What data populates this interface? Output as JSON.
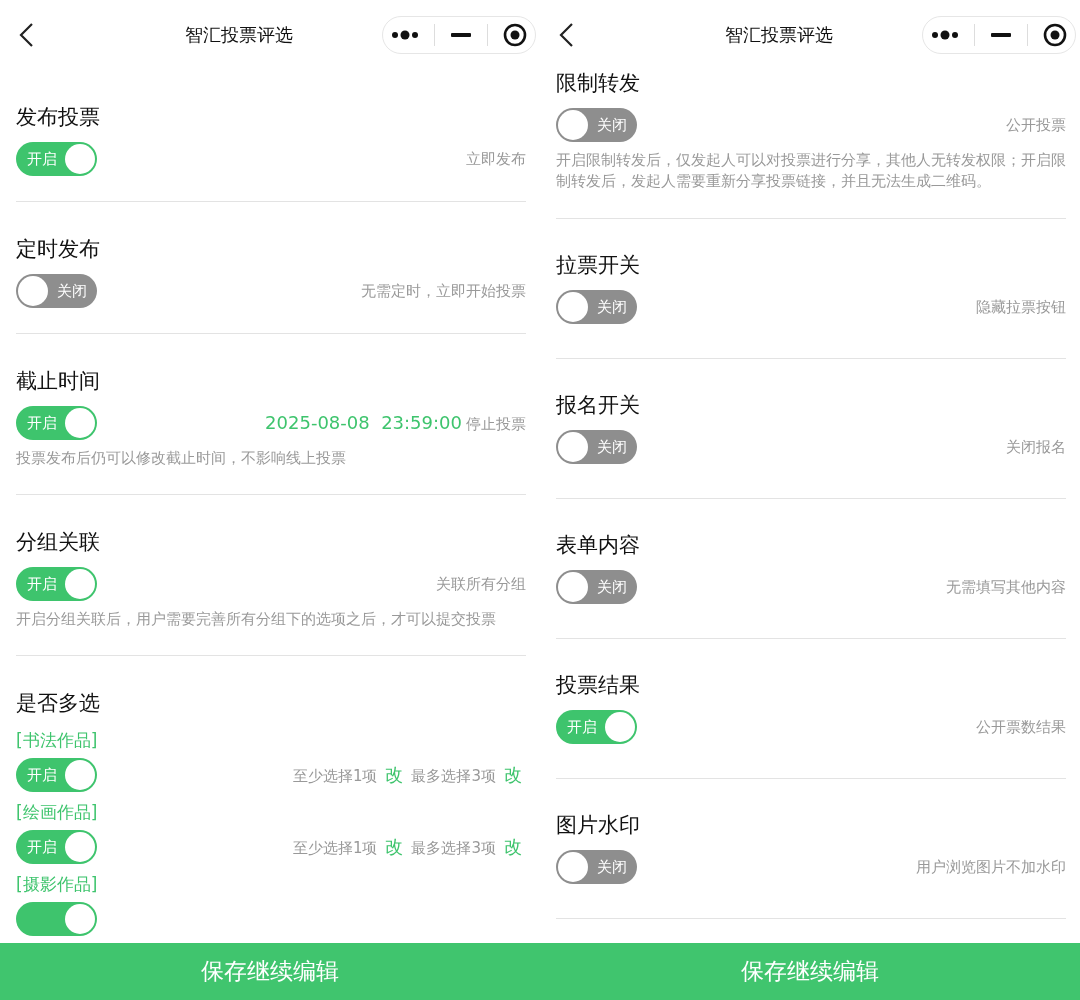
{
  "screens": [
    {
      "title": "智汇投票评选",
      "settings": [
        {
          "title": "发布投票",
          "on": true,
          "toggle_label": "开启",
          "note": [
            {
              "kind": "text",
              "text": "立即发布"
            }
          ]
        },
        {
          "title": "定时发布",
          "on": false,
          "toggle_label": "关闭",
          "note": [
            {
              "kind": "text",
              "text": "无需定时，立即开始投票"
            }
          ]
        },
        {
          "title": "截止时间",
          "on": true,
          "toggle_label": "开启",
          "note": [
            {
              "kind": "value",
              "text": "2025-08-08  23:59:00"
            },
            {
              "kind": "text",
              "text": "停止投票"
            }
          ],
          "description": "投票发布后仍可以修改截止时间，不影响线上投票"
        },
        {
          "title": "分组关联",
          "on": true,
          "toggle_label": "开启",
          "note": [
            {
              "kind": "text",
              "text": "关联所有分组"
            }
          ],
          "description": "开启分组关联后，用户需要完善所有分组下的选项之后，才可以提交投票"
        },
        {
          "title": "是否多选",
          "groups": [
            {
              "name": "[书法作品]",
              "on": true,
              "toggle_label": "开启",
              "note": [
                {
                  "kind": "text",
                  "text": "至少选择1项"
                },
                {
                  "kind": "link",
                  "text": "改"
                },
                {
                  "kind": "text",
                  "text": "最多选择3项"
                },
                {
                  "kind": "link",
                  "text": "改"
                }
              ]
            },
            {
              "name": "[绘画作品]",
              "on": true,
              "toggle_label": "开启",
              "note": [
                {
                  "kind": "text",
                  "text": "至少选择1项"
                },
                {
                  "kind": "link",
                  "text": "改"
                },
                {
                  "kind": "text",
                  "text": "最多选择3项"
                },
                {
                  "kind": "link",
                  "text": "改"
                }
              ]
            },
            {
              "name": "[摄影作品]",
              "on": true
            }
          ]
        }
      ],
      "save_button": "保存继续编辑"
    },
    {
      "title": "智汇投票评选",
      "settings": [
        {
          "title": "限制转发",
          "on": false,
          "toggle_label": "关闭",
          "note": [
            {
              "kind": "text",
              "text": "公开投票"
            }
          ],
          "description": "开启限制转发后，仅发起人可以对投票进行分享，其他人无转发权限；开启限制转发后，发起人需要重新分享投票链接，并且无法生成二维码。"
        },
        {
          "title": "拉票开关",
          "on": false,
          "toggle_label": "关闭",
          "note": [
            {
              "kind": "text",
              "text": "隐藏拉票按钮"
            }
          ]
        },
        {
          "title": "报名开关",
          "on": false,
          "toggle_label": "关闭",
          "note": [
            {
              "kind": "text",
              "text": "关闭报名"
            }
          ]
        },
        {
          "title": "表单内容",
          "on": false,
          "toggle_label": "关闭",
          "note": [
            {
              "kind": "text",
              "text": "无需填写其他内容"
            }
          ]
        },
        {
          "title": "投票结果",
          "on": true,
          "toggle_label": "开启",
          "note": [
            {
              "kind": "text",
              "text": "公开票数结果"
            }
          ]
        },
        {
          "title": "图片水印",
          "on": false,
          "toggle_label": "关闭",
          "note": [
            {
              "kind": "text",
              "text": "用户浏览图片不加水印"
            }
          ]
        }
      ],
      "save_button": "保存继续编辑"
    }
  ]
}
